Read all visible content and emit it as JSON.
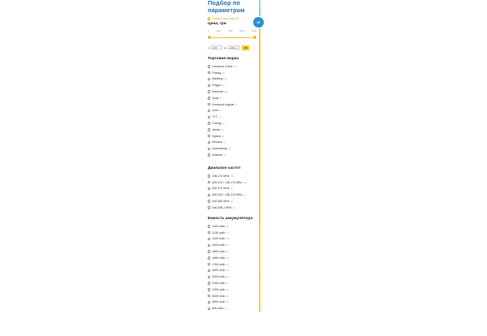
{
  "filter": {
    "title": "Подбор по параметрам",
    "only_good_label": "Только Gold цена",
    "only_good_count": "(4)",
    "badge_label": "00"
  },
  "price": {
    "title": "Цена, грн",
    "ticks": [
      "0",
      "2000",
      "3000",
      "5000",
      "8000"
    ],
    "slider_min_fraction": 0.0,
    "slider_max_fraction": 1.0,
    "from_label": "от",
    "from_value": "509",
    "to_label": "до",
    "to_value": "18619",
    "ok_label": "OK"
  },
  "brand": {
    "title": "Торговая марка",
    "items": [
      {
        "label": "Kenwood China",
        "count": "(21)"
      },
      {
        "label": "Puxing",
        "count": "(6)"
      },
      {
        "label": "Baofeng",
        "count": "(11)"
      },
      {
        "label": "Kingpo",
        "count": "(4)"
      },
      {
        "label": "Motorola",
        "count": "(10)"
      },
      {
        "label": "Quat",
        "count": "(1)"
      },
      {
        "label": "Kenwood original",
        "count": "(3)"
      },
      {
        "label": "Icom",
        "count": "(1)"
      },
      {
        "label": "TYT",
        "count": "(1)"
      },
      {
        "label": "Pofung",
        "count": "(2)"
      },
      {
        "label": "Vertex",
        "count": "(2)"
      },
      {
        "label": "Hytera",
        "count": "(2)"
      },
      {
        "label": "Wouxun",
        "count": "(1)"
      },
      {
        "label": "Quansheng",
        "count": "(2)"
      },
      {
        "label": "Zastone",
        "count": "(1)"
      }
    ]
  },
  "freq": {
    "title": "Диапазон частот",
    "items": [
      {
        "label": "136-174 MHz",
        "count": "(11)"
      },
      {
        "label": "400-470 / 136-174 MHz",
        "count": "(24)"
      },
      {
        "label": "400-470 MHz",
        "count": "(4)"
      },
      {
        "label": "400-520 / 136-174 MHz",
        "count": "(2)"
      },
      {
        "label": "440-480 MHz",
        "count": "(1)"
      },
      {
        "label": "446-446.1 MHz",
        "count": "(2)"
      }
    ]
  },
  "battery": {
    "title": "Емкость аккумулятора",
    "items": [
      {
        "label": "1100 mAh",
        "count": "(3)"
      },
      {
        "label": "1130 mAh",
        "count": "(1)"
      },
      {
        "label": "1200 mAh",
        "count": "(11)"
      },
      {
        "label": "1500 mAh",
        "count": "(3)"
      },
      {
        "label": "1600 mAh",
        "count": "(2)"
      },
      {
        "label": "1650 mAh",
        "count": "(3)"
      },
      {
        "label": "1700 mAh",
        "count": "(2)"
      },
      {
        "label": "1800 mAh",
        "count": "(6)"
      },
      {
        "label": "2000 mAh",
        "count": "(3)"
      },
      {
        "label": "2100 mAh",
        "count": "(1)"
      },
      {
        "label": "2200 mAh",
        "count": "(2)"
      },
      {
        "label": "3000 mAh",
        "count": "(3)"
      },
      {
        "label": "3600 mAh",
        "count": "(1)"
      },
      {
        "label": "800 mAh",
        "count": "(1)"
      }
    ]
  }
}
